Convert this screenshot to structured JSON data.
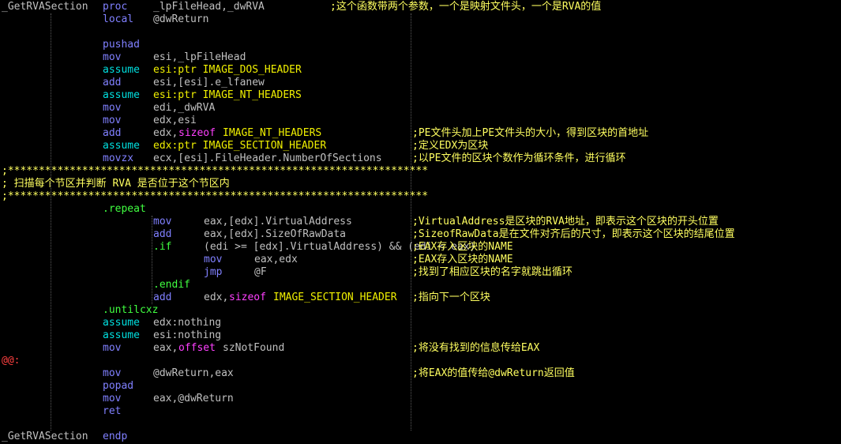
{
  "colors": {
    "background": "#000000",
    "plain": "#c0c0c0",
    "keyword": "#8080ff",
    "directive": "#00e0e0",
    "operator": "#ff40ff",
    "structure": "#f0f000",
    "comment": "#ffff60",
    "block": "#40ff40",
    "label": "#ff4040"
  },
  "lines": [
    {
      "tokens": [
        {
          "text": "_GetRVASection",
          "role": "plain",
          "col": 0
        },
        {
          "text": "proc",
          "role": "keyword",
          "col": 16
        },
        {
          "text": "_lpFileHead,_dwRVA",
          "role": "plain",
          "col": 24
        },
        {
          "text": ";这个函数带两个参数，一个是映射文件头，一个是RVA的值",
          "role": "comment",
          "col": 52
        }
      ]
    },
    {
      "tokens": [
        {
          "text": "local",
          "role": "keyword",
          "col": 16
        },
        {
          "text": "@dwReturn",
          "role": "plain",
          "col": 24
        }
      ]
    },
    {
      "tokens": []
    },
    {
      "tokens": [
        {
          "text": "pushad",
          "role": "keyword",
          "col": 16
        }
      ]
    },
    {
      "tokens": [
        {
          "text": "mov",
          "role": "keyword",
          "col": 16
        },
        {
          "text": "esi,_lpFileHead",
          "role": "plain",
          "col": 24
        }
      ]
    },
    {
      "tokens": [
        {
          "text": "assume",
          "role": "directive",
          "col": 16
        },
        {
          "text": "esi:ptr IMAGE_DOS_HEADER",
          "role": "structure",
          "col": 24
        }
      ]
    },
    {
      "tokens": [
        {
          "text": "add",
          "role": "keyword",
          "col": 16
        },
        {
          "text": "esi,[esi].e_lfanew",
          "role": "plain",
          "col": 24
        }
      ]
    },
    {
      "tokens": [
        {
          "text": "assume",
          "role": "directive",
          "col": 16
        },
        {
          "text": "esi:ptr IMAGE_NT_HEADERS",
          "role": "structure",
          "col": 24
        }
      ]
    },
    {
      "tokens": [
        {
          "text": "mov",
          "role": "keyword",
          "col": 16
        },
        {
          "text": "edi,_dwRVA",
          "role": "plain",
          "col": 24
        }
      ]
    },
    {
      "tokens": [
        {
          "text": "mov",
          "role": "keyword",
          "col": 16
        },
        {
          "text": "edx,esi",
          "role": "plain",
          "col": 24
        }
      ]
    },
    {
      "tokens": [
        {
          "text": "add",
          "role": "keyword",
          "col": 16
        },
        {
          "text": "edx,",
          "role": "plain",
          "col": 24
        },
        {
          "text": "sizeof",
          "role": "operator",
          "col": 28
        },
        {
          "text": "IMAGE_NT_HEADERS",
          "role": "structure",
          "col": 35
        },
        {
          "text": ";PE文件头加上PE文件头的大小，得到区块的首地址",
          "role": "comment",
          "col": 65
        }
      ]
    },
    {
      "tokens": [
        {
          "text": "assume",
          "role": "directive",
          "col": 16
        },
        {
          "text": "edx:ptr IMAGE_SECTION_HEADER",
          "role": "structure",
          "col": 24
        },
        {
          "text": ";定义EDX为区块",
          "role": "comment",
          "col": 65
        }
      ]
    },
    {
      "tokens": [
        {
          "text": "movzx",
          "role": "keyword",
          "col": 16
        },
        {
          "text": "ecx,[esi].FileHeader.NumberOfSections",
          "role": "plain",
          "col": 24
        },
        {
          "text": ";以PE文件的区块个数作为循环条件，进行循环",
          "role": "comment",
          "col": 65
        }
      ]
    },
    {
      "tokens": [
        {
          "text": ";********************************************************************",
          "role": "comment",
          "col": 0
        }
      ]
    },
    {
      "tokens": [
        {
          "text": "; 扫描每个节区并判断 RVA 是否位于这个节区内",
          "role": "comment",
          "col": 0
        }
      ]
    },
    {
      "tokens": [
        {
          "text": ";********************************************************************",
          "role": "comment",
          "col": 0
        }
      ]
    },
    {
      "tokens": [
        {
          "text": ".repeat",
          "role": "block",
          "col": 16
        }
      ]
    },
    {
      "tokens": [
        {
          "text": "mov",
          "role": "keyword",
          "col": 24
        },
        {
          "text": "eax,[edx].VirtualAddress",
          "role": "plain",
          "col": 32
        },
        {
          "text": ";VirtualAddress是区块的RVA地址，即表示这个区块的开头位置",
          "role": "comment",
          "col": 65
        }
      ]
    },
    {
      "tokens": [
        {
          "text": "add",
          "role": "keyword",
          "col": 24
        },
        {
          "text": "eax,[edx].SizeOfRawData",
          "role": "plain",
          "col": 32
        },
        {
          "text": ";SizeofRawData是在文件对齐后的尺寸，即表示这个区块的结尾位置",
          "role": "comment",
          "col": 65
        }
      ]
    },
    {
      "tokens": [
        {
          "text": ".if",
          "role": "block",
          "col": 24
        },
        {
          "text": "(edi >= [edx].VirtualAddress) && (edi < eax)",
          "role": "plain",
          "col": 32
        },
        {
          "text": ";EAX存入区块的NAME",
          "role": "comment",
          "col": 65
        }
      ]
    },
    {
      "tokens": [
        {
          "text": "mov",
          "role": "keyword",
          "col": 32
        },
        {
          "text": "eax,edx",
          "role": "plain",
          "col": 40
        },
        {
          "text": ";EAX存入区块的NAME",
          "role": "comment",
          "col": 65
        }
      ]
    },
    {
      "tokens": [
        {
          "text": "jmp",
          "role": "keyword",
          "col": 32
        },
        {
          "text": "@F",
          "role": "plain",
          "col": 40
        },
        {
          "text": ";找到了相应区块的名字就跳出循环",
          "role": "comment",
          "col": 65
        }
      ]
    },
    {
      "tokens": [
        {
          "text": ".endif",
          "role": "block",
          "col": 24
        }
      ]
    },
    {
      "tokens": [
        {
          "text": "add",
          "role": "keyword",
          "col": 24
        },
        {
          "text": "edx,",
          "role": "plain",
          "col": 32
        },
        {
          "text": "sizeof",
          "role": "operator",
          "col": 36
        },
        {
          "text": "IMAGE_SECTION_HEADER",
          "role": "structure",
          "col": 43
        },
        {
          "text": ";指向下一个区块",
          "role": "comment",
          "col": 65
        }
      ]
    },
    {
      "tokens": [
        {
          "text": ".untilcxz",
          "role": "block",
          "col": 16
        }
      ]
    },
    {
      "tokens": [
        {
          "text": "assume",
          "role": "directive",
          "col": 16
        },
        {
          "text": "edx:nothing",
          "role": "plain",
          "col": 24
        }
      ]
    },
    {
      "tokens": [
        {
          "text": "assume",
          "role": "directive",
          "col": 16
        },
        {
          "text": "esi:nothing",
          "role": "plain",
          "col": 24
        }
      ]
    },
    {
      "tokens": [
        {
          "text": "mov",
          "role": "keyword",
          "col": 16
        },
        {
          "text": "eax,",
          "role": "plain",
          "col": 24
        },
        {
          "text": "offset",
          "role": "operator",
          "col": 28
        },
        {
          "text": "szNotFound",
          "role": "plain",
          "col": 35
        },
        {
          "text": ";将没有找到的信息传给EAX",
          "role": "comment",
          "col": 65
        }
      ]
    },
    {
      "tokens": [
        {
          "text": "@@:",
          "role": "label",
          "col": 0
        }
      ]
    },
    {
      "tokens": [
        {
          "text": "mov",
          "role": "keyword",
          "col": 16
        },
        {
          "text": "@dwReturn,eax",
          "role": "plain",
          "col": 24
        },
        {
          "text": ";将EAX的值传给@dwReturn返回值",
          "role": "comment",
          "col": 65
        }
      ]
    },
    {
      "tokens": [
        {
          "text": "popad",
          "role": "keyword",
          "col": 16
        }
      ]
    },
    {
      "tokens": [
        {
          "text": "mov",
          "role": "keyword",
          "col": 16
        },
        {
          "text": "eax,@dwReturn",
          "role": "plain",
          "col": 24
        }
      ]
    },
    {
      "tokens": [
        {
          "text": "ret",
          "role": "keyword",
          "col": 16
        }
      ]
    },
    {
      "tokens": []
    },
    {
      "tokens": [
        {
          "text": "_GetRVASection",
          "role": "plain",
          "col": 0
        },
        {
          "text": "endp",
          "role": "keyword",
          "col": 16
        }
      ]
    }
  ]
}
